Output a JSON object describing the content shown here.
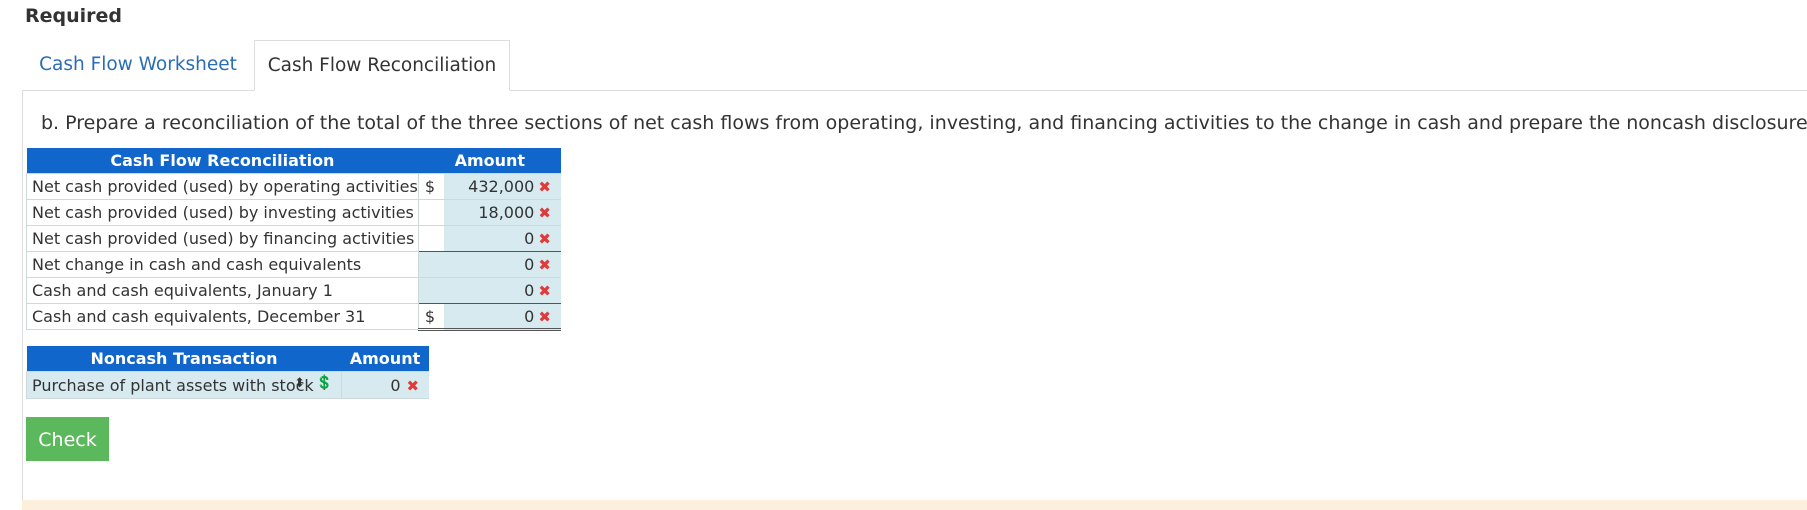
{
  "header": {
    "required_label": "Required"
  },
  "tabs": [
    {
      "label": "Cash Flow Worksheet",
      "active": false
    },
    {
      "label": "Cash Flow Reconciliation",
      "active": true
    }
  ],
  "instruction": "b. Prepare a reconciliation of the total of the three sections of net cash flows from operating, investing, and financing activities to the change in cash and prepare the noncash disclosure note.",
  "reconciliation": {
    "header_label": "Cash Flow Reconciliation",
    "header_amount": "Amount",
    "rows": [
      {
        "label": "Net cash provided (used) by operating activities",
        "currency": "$",
        "amount": "432,000",
        "status": "incorrect"
      },
      {
        "label": "Net cash provided (used) by investing activities",
        "currency": "",
        "amount": "18,000",
        "status": "incorrect"
      },
      {
        "label": "Net cash provided (used) by financing activities",
        "currency": "",
        "amount": "0",
        "status": "incorrect"
      },
      {
        "label": "Net change in cash and cash equivalents",
        "currency": "",
        "amount": "0",
        "status": "incorrect"
      },
      {
        "label": "Cash and cash equivalents, January 1",
        "currency": "",
        "amount": "0",
        "status": "incorrect"
      },
      {
        "label": "Cash and cash equivalents, December 31",
        "currency": "$",
        "amount": "0",
        "status": "incorrect"
      }
    ]
  },
  "noncash": {
    "header_label": "Noncash Transaction",
    "header_amount": "Amount",
    "rows": [
      {
        "label": "Purchase of plant assets with stock",
        "amount": "0",
        "status": "incorrect"
      }
    ]
  },
  "check_button": "Check",
  "icons": {
    "incorrect": "x-mark-icon",
    "select": "sort-arrows-icon",
    "adjust": "dollar-adjust-icon"
  },
  "colors": {
    "header_blue": "#1166cc",
    "input_bg": "#d6eaf0",
    "check_green": "#5cb85c",
    "error_red": "#e03b3b",
    "tab_link": "#2a6db5"
  }
}
